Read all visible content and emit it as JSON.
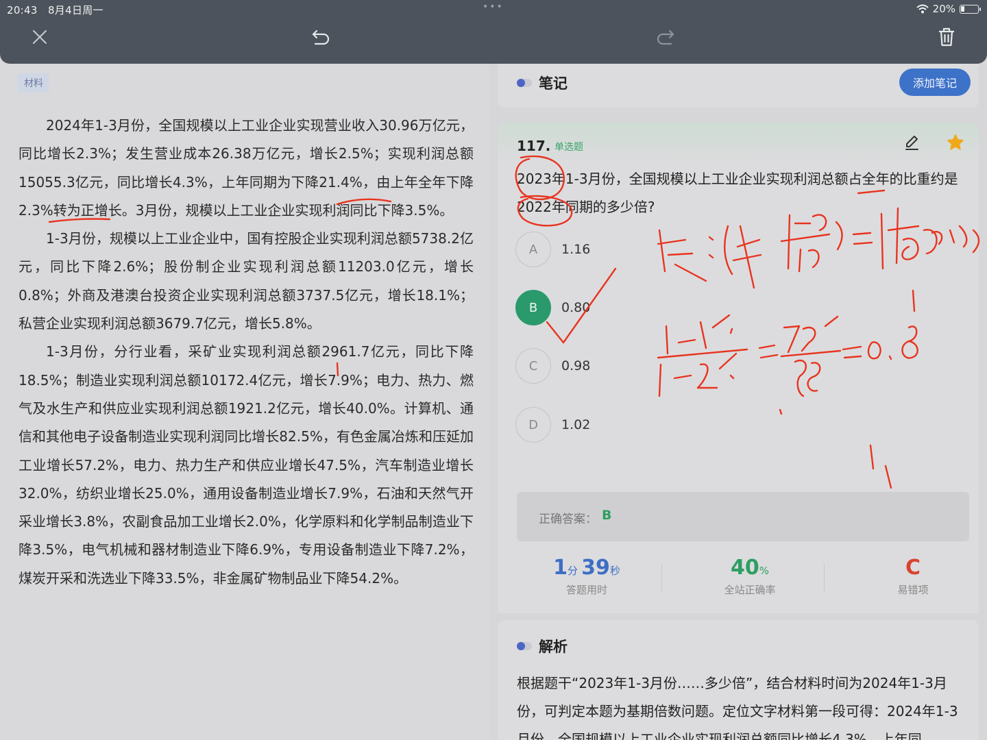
{
  "status": {
    "time": "20:43",
    "date": "8月4日周一",
    "battery": "20%"
  },
  "material": {
    "tag": "材料",
    "paragraphs": [
      "2024年1-3月份，全国规模以上工业企业实现营业收入30.96万亿元，同比增长2.3%；发生营业成本26.38万亿元，增长2.5%；实现利润总额15055.3亿元，同比增长4.3%，上年同期为下降21.4%，由上年全年下降2.3%转为正增长。3月份，规模以上工业企业实现利润同比下降3.5%。",
      "1-3月份，规模以上工业企业中，国有控股企业实现利润总额5738.2亿元，同比下降2.6%；股份制企业实现利润总额11203.0亿元，增长0.8%；外商及港澳台投资企业实现利润总额3737.5亿元，增长18.1%；私营企业实现利润总额3679.7亿元，增长5.8%。",
      "1-3月份，分行业看，采矿业实现利润总额2961.7亿元，同比下降18.5%；制造业实现利润总额10172.4亿元，增长7.9%；电力、热力、燃气及水生产和供应业实现利润总额1921.2亿元，增长40.0%。计算机、通信和其他电子设备制造业实现利润同比增长82.5%，有色金属冶炼和压延加工业增长57.2%，电力、热力生产和供应业增长47.5%，汽车制造业增长32.0%，纺织业增长25.0%，通用设备制造业增长7.9%，石油和天然气开采业增长3.8%，农副食品加工业增长2.0%，化学原料和化学制品制造业下降3.5%，电气机械和器材制造业下降6.9%，专用设备制造业下降7.2%，煤炭开采和洗选业下降33.5%，非金属矿物制品业下降54.2%。"
    ]
  },
  "notes": {
    "title": "笔记",
    "add_label": "添加笔记"
  },
  "question": {
    "number": "117.",
    "type": "单选题",
    "stem": "2023年1-3月份，全国规模以上工业企业实现利润总额占全年的比重约是2022年同期的多少倍?",
    "options": [
      {
        "letter": "A",
        "value": "1.16"
      },
      {
        "letter": "B",
        "value": "0.80"
      },
      {
        "letter": "C",
        "value": "0.98"
      },
      {
        "letter": "D",
        "value": "1.02"
      }
    ],
    "selected": "B"
  },
  "answer": {
    "label": "正确答案：",
    "value": "B",
    "time": {
      "min": "1",
      "min_unit": "分",
      "sec": "39",
      "sec_unit": "秒",
      "label": "答题用时"
    },
    "accuracy": {
      "value": "40",
      "unit": "%",
      "label": "全站正确率"
    },
    "wrong": {
      "value": "C",
      "label": "易错项"
    }
  },
  "explanation": {
    "title": "解析",
    "text": "根据题干“2023年1-3月份……多少倍”，结合材料时间为2024年1-3月份，可判定本题为基期倍数问题。定位文字材料第一段可得：2024年1-3月份，全国规模以上工业企业实现利润总额同比增长4.3%，上年同"
  },
  "colors": {
    "accent": "#3d72c9",
    "correct": "#2e9e62",
    "wrong": "#d9432f",
    "ink": "#e8341f"
  }
}
